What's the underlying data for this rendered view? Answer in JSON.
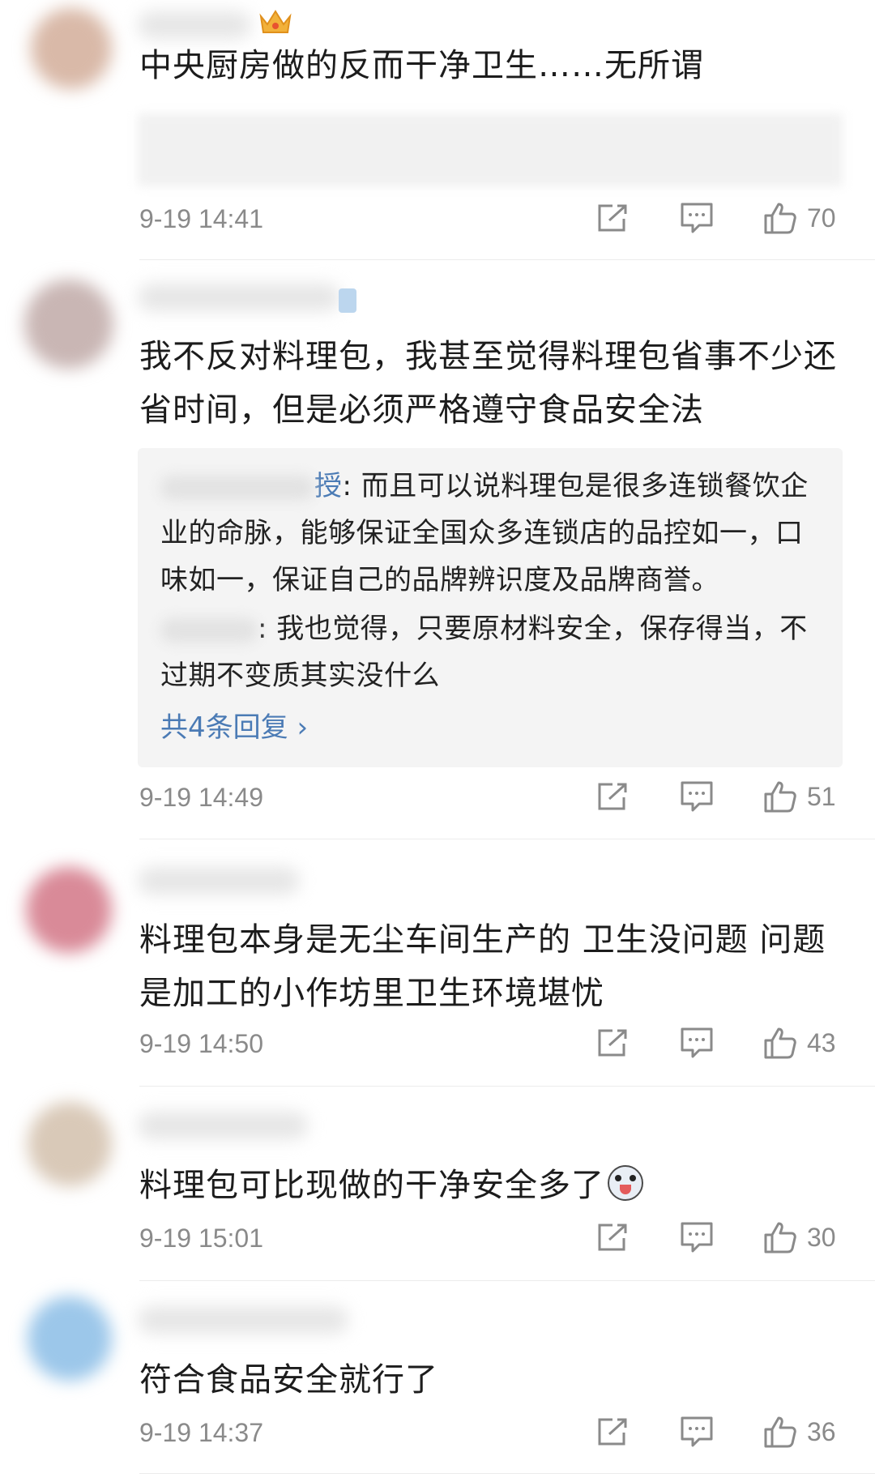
{
  "comments": [
    {
      "text": "中央厨房做的反而干净卫生……无所谓",
      "time": "9-19 14:41",
      "likes": "70"
    },
    {
      "text": "我不反对料理包，我甚至觉得料理包省事不少还省时间，但是必须严格遵守食品安全法",
      "time": "9-19 14:49",
      "likes": "51",
      "replies": [
        {
          "author_tail": "授",
          "text": ": 而且可以说料理包是很多连锁餐饮企业的命脉，能够保证全国众多连锁店的品控如一，口味如一，保证自己的品牌辨识度及品牌商誉。"
        },
        {
          "author_tail": "",
          "text": ": 我也觉得，只要原材料安全，保存得当，不过期不变质其实没什么"
        }
      ],
      "more_replies": "共4条回复 ›"
    },
    {
      "text": "料理包本身是无尘车间生产的 卫生没问题 问题是加工的小作坊里卫生环境堪忧",
      "time": "9-19 14:50",
      "likes": "43"
    },
    {
      "text": "料理包可比现做的干净安全多了",
      "time": "9-19 15:01",
      "likes": "30",
      "emoji": "husky-emoji"
    },
    {
      "text": "符合食品安全就行了",
      "time": "9-19 14:37",
      "likes": "36"
    }
  ],
  "icons": {
    "share": "share-icon",
    "comment": "comment-icon",
    "like": "thumbs-up-icon",
    "badge": "crown-icon"
  },
  "colors": {
    "link": "#4b7bb5",
    "meta": "#8a8a8a",
    "reply_bg": "#f4f4f4"
  }
}
